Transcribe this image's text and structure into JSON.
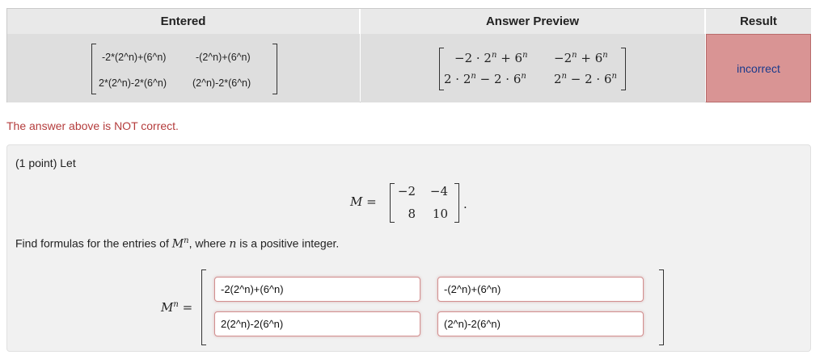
{
  "table": {
    "headers": [
      "Entered",
      "Answer Preview",
      "Result"
    ],
    "entered": [
      [
        "-2*(2^n)+(6^n)",
        "-(2^n)+(6^n)"
      ],
      [
        "2*(2^n)-2*(6^n)",
        "(2^n)-2*(6^n)"
      ]
    ],
    "preview": [
      [
        "−2 · 2",
        "+ 6",
        "−2",
        "+ 6"
      ],
      [
        "2 · 2",
        "− 2 · 6",
        "2",
        "− 2 · 6"
      ]
    ],
    "preview_exp": "n",
    "result": "incorrect"
  },
  "feedback": "The answer above is NOT correct.",
  "problem": {
    "points": "(1 point) Let",
    "matrix_label": "M =",
    "matrix": [
      [
        "−2",
        "−4"
      ],
      [
        "8",
        "10"
      ]
    ],
    "period": ".",
    "find_pre": "Find formulas for the entries of ",
    "find_M": "M",
    "find_exp": "n",
    "find_mid": ", where ",
    "find_n": "n",
    "find_post": " is a positive integer.",
    "answer_label": "M",
    "answer_label_exp": "n",
    "answer_eq": "=",
    "inputs": [
      [
        "-2(2^n)+(6^n)",
        "-(2^n)+(6^n)"
      ],
      [
        "2(2^n)-2(6^n)",
        "(2^n)-2(6^n)"
      ]
    ]
  },
  "colors": {
    "result_bg": "#d99494",
    "feedback": "#b43c3c",
    "input_border": "#d28f8f"
  }
}
